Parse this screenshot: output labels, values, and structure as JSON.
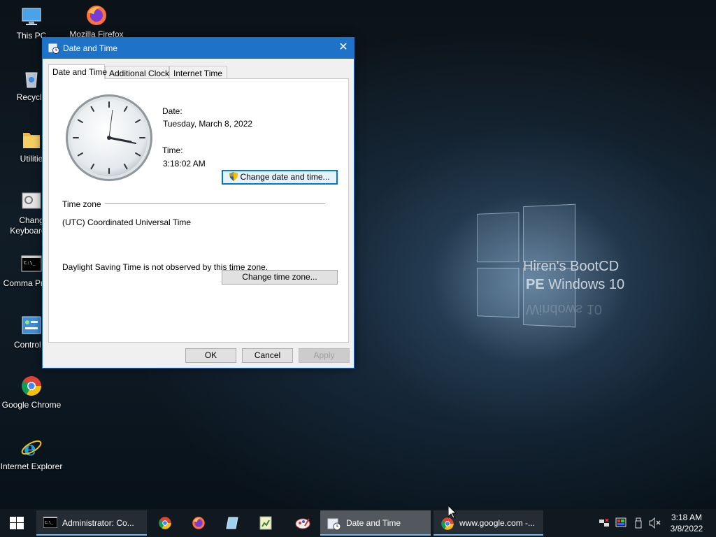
{
  "desktop": {
    "icons": [
      {
        "label": "This PC"
      },
      {
        "label": "Mozilla Firefox"
      },
      {
        "label": "Recycle"
      },
      {
        "label": "Utilitie"
      },
      {
        "label": "Chang Keyboard L"
      },
      {
        "label": "Comma Promp"
      },
      {
        "label": "Control P"
      },
      {
        "label": "Google Chrome"
      },
      {
        "label": "Internet Explorer"
      }
    ],
    "wallpaper": {
      "title": "Hiren's BootCD",
      "subtitle_bold": "PE",
      "subtitle_rest": " Windows 10",
      "reflection": "Windows 10"
    }
  },
  "dialog": {
    "title": "Date and Time",
    "tabs": [
      "Date and Time",
      "Additional Clocks",
      "Internet Time"
    ],
    "date_label": "Date:",
    "date_value": "Tuesday, March 8, 2022",
    "time_label": "Time:",
    "time_value": "3:18:02 AM",
    "change_datetime_button": "Change date and time...",
    "timezone_heading": "Time zone",
    "timezone_value": "(UTC) Coordinated Universal Time",
    "change_timezone_button": "Change time zone...",
    "dst_note": "Daylight Saving Time is not observed by this time zone.",
    "ok_button": "OK",
    "cancel_button": "Cancel",
    "apply_button": "Apply"
  },
  "taskbar": {
    "items": [
      {
        "label": "Administrator: Co...",
        "icon": "cmd-icon"
      },
      {
        "label": "Date and Time",
        "icon": "date-time-icon"
      },
      {
        "label": "www.google.com -...",
        "icon": "chrome-icon"
      }
    ],
    "pinned": [
      "chrome-icon",
      "firefox-icon",
      "notepad-icon",
      "spreadsheet-icon",
      "paint-icon"
    ],
    "clock_time": "3:18 AM",
    "clock_date": "3/8/2022"
  },
  "colors": {
    "accent": "#1e73c9",
    "taskbar": "#101820"
  }
}
